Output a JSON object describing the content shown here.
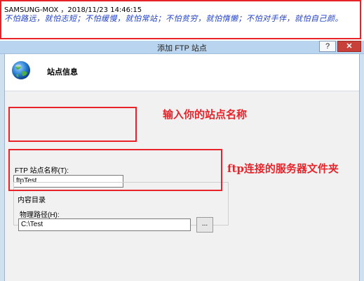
{
  "note": {
    "meta": "SAMSUNG-MOX ，2018/11/23 14:46:15",
    "quote": "不怕路远，就怕志短；不怕缓慢，就怕常站；不怕贫穷，就怕惰懒；不怕对手伴，就怕自己颜。"
  },
  "dialog": {
    "title": "添加 FTP 站点",
    "help_label": "?",
    "close_label": "✕",
    "header_title": "站点信息",
    "site_name_label": "FTP 站点名称(T):",
    "site_name_value": "ftpTest",
    "content_dir_label": "内容目录",
    "physical_path_label": "物理路径(H):",
    "physical_path_value": "C:\\Test",
    "browse_label": "..."
  },
  "annotations": {
    "site_name_callout": "输入你的站点名称",
    "path_callout": "ftp连接的服务器文件夹"
  },
  "colors": {
    "annotation_red": "#e8242a",
    "quote_blue": "#1e3ec9",
    "titlebar_blue": "#b8d4ee",
    "close_red": "#c7413a"
  },
  "icons": [
    "globe-icon"
  ]
}
